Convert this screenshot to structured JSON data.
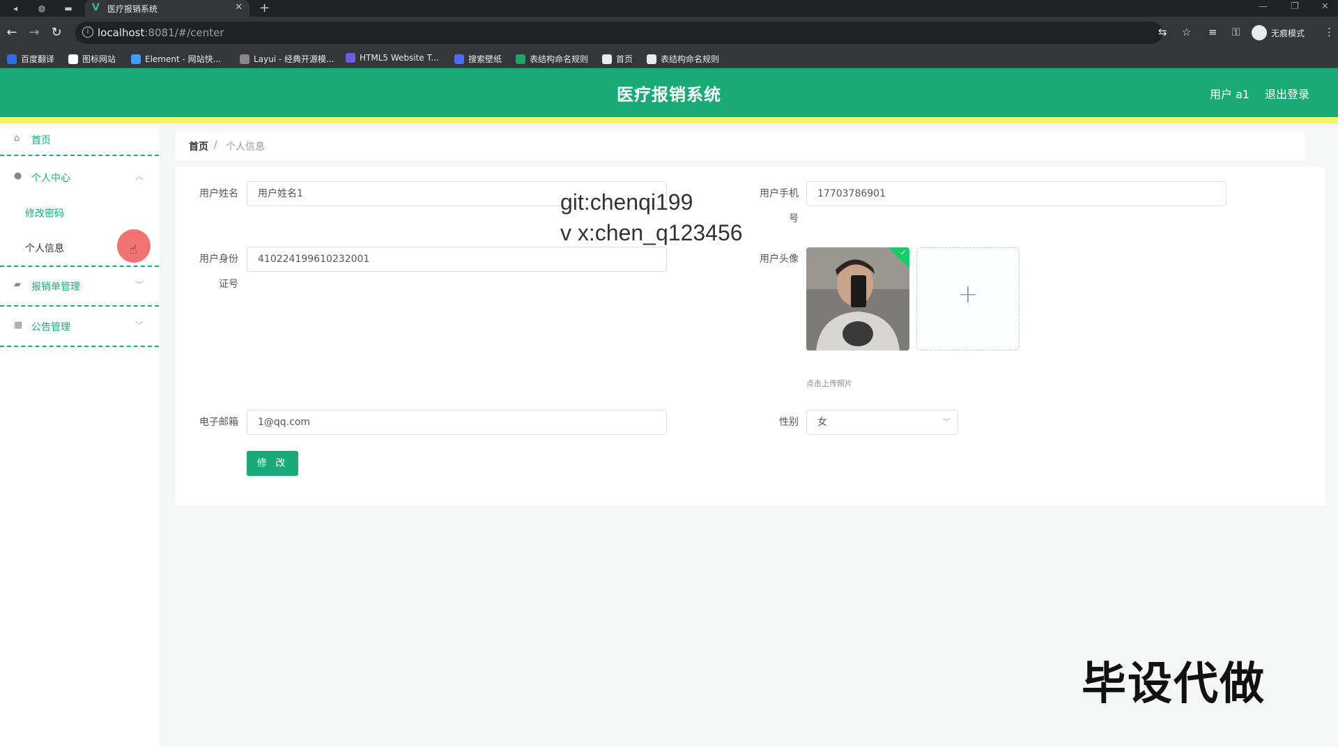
{
  "browser": {
    "tab_title": "医疗报销系统",
    "url_host": "localhost",
    "url_rest": ":8081/#/center",
    "profile_label": "无痕模式",
    "bookmarks": [
      {
        "label": "百度翻译",
        "color": "#2f6fe4"
      },
      {
        "label": "图标网站",
        "color": "#ffffff"
      },
      {
        "label": "Element - 网站快...",
        "color": "#409eff"
      },
      {
        "label": "Layui - 经典开源模...",
        "color": "#888888"
      },
      {
        "label": "HTML5 Website T...",
        "color": "#6c5ce7"
      },
      {
        "label": "搜索壁纸",
        "color": "#4a6cf7"
      },
      {
        "label": "表结构命名规则",
        "color": "#21a366"
      },
      {
        "label": "首页",
        "color": "#e8eaed"
      },
      {
        "label": "表结构命名规则",
        "color": "#e8eaed"
      }
    ]
  },
  "header": {
    "title": "医疗报销系统",
    "user": "用户 a1",
    "logout": "退出登录",
    "colors": {
      "primary": "#1aaa78",
      "stripe": "#f3f566"
    }
  },
  "sidebar": {
    "home": "首页",
    "personal_center": "个人中心",
    "change_password": "修改密码",
    "personal_info": "个人信息",
    "reimbursement": "报销单管理",
    "notice": "公告管理"
  },
  "breadcrumb": {
    "home": "首页",
    "sep": "/",
    "current": "个人信息"
  },
  "form": {
    "name_label": "用户姓名",
    "name_value": "用户姓名1",
    "phone_label_1": "用户手机",
    "phone_label_2": "号",
    "phone_value": "17703786901",
    "id_label_1": "用户身份",
    "id_label_2": "证号",
    "id_value": "410224199610232001",
    "avatar_label": "用户头像",
    "upload_tip": "点击上传照片",
    "email_label": "电子邮箱",
    "email_value": "1@qq.com",
    "gender_label": "性别",
    "gender_value": "女",
    "submit": "修 改"
  },
  "watermarks": {
    "git": "git:chenqi199",
    "vx": "v x:chen_q123456",
    "promo": "毕设代做"
  }
}
